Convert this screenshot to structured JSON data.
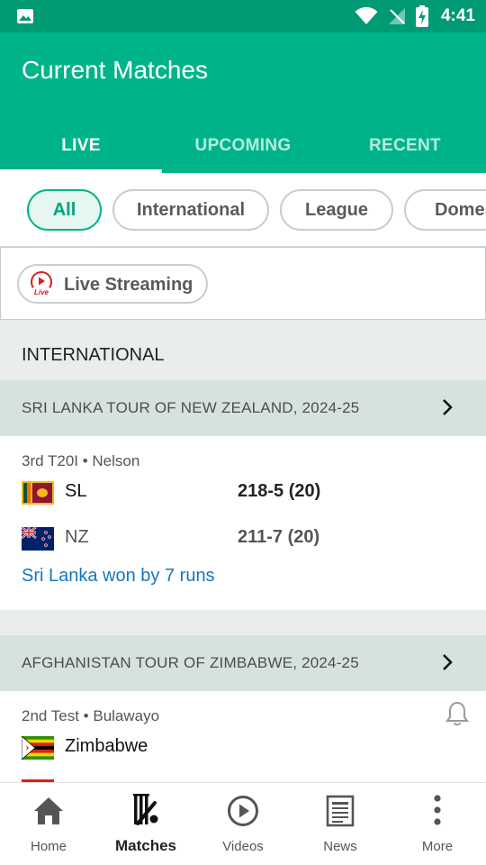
{
  "status_bar": {
    "time": "4:41"
  },
  "app": {
    "title": "Current Matches"
  },
  "tabs": [
    {
      "label": "LIVE",
      "active": true
    },
    {
      "label": "UPCOMING",
      "active": false
    },
    {
      "label": "RECENT",
      "active": false
    }
  ],
  "filters": [
    {
      "label": "All",
      "active": true
    },
    {
      "label": "International",
      "active": false
    },
    {
      "label": "League",
      "active": false
    },
    {
      "label": "Domestic",
      "active": false
    }
  ],
  "live_streaming": {
    "label": "Live Streaming",
    "badge": "Live"
  },
  "sections": [
    {
      "title": "INTERNATIONAL",
      "series": [
        {
          "name": "SRI LANKA TOUR OF NEW ZEALAND, 2024-25",
          "match": {
            "meta": "3rd T20I • Nelson",
            "teams": [
              {
                "name": "SL",
                "score": "218-5 (20)",
                "flag": "sri-lanka-flag"
              },
              {
                "name": "NZ",
                "score": "211-7 (20)",
                "flag": "new-zealand-flag"
              }
            ],
            "result": "Sri Lanka won by 7 runs"
          }
        },
        {
          "name": "AFGHANISTAN TOUR OF ZIMBABWE, 2024-25",
          "match": {
            "meta": "2nd Test • Bulawayo",
            "teams": [
              {
                "name": "Zimbabwe",
                "score": "",
                "flag": "zimbabwe-flag"
              }
            ]
          }
        }
      ]
    }
  ],
  "bottom_nav": [
    {
      "label": "Home",
      "icon": "home-icon",
      "active": false
    },
    {
      "label": "Matches",
      "icon": "matches-icon",
      "active": true
    },
    {
      "label": "Videos",
      "icon": "play-circle-icon",
      "active": false
    },
    {
      "label": "News",
      "icon": "newspaper-icon",
      "active": false
    },
    {
      "label": "More",
      "icon": "more-vertical-icon",
      "active": false
    }
  ],
  "colors": {
    "status_bar": "#009a74",
    "app_bar": "#00b48a",
    "result_link": "#1577bf",
    "series_header": "#d6e2df"
  }
}
